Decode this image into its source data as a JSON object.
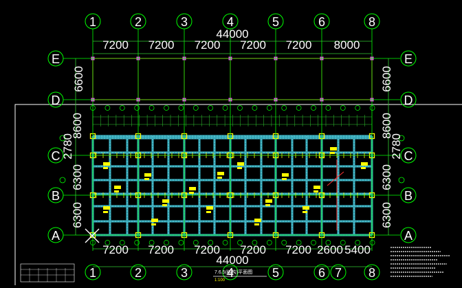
{
  "colors": {
    "axis_green": "#00ff00",
    "dim_green": "#33cc33",
    "axis_white": "#ffffff",
    "span_red": "#ff3333",
    "beam_cyan": "#34a7b7",
    "beam_light": "#7fd9e6",
    "column_yellow": "#ffff00",
    "node_magenta": "#ff44ff",
    "border_white": "#ffffff"
  },
  "drawing": {
    "grid_x_labels": [
      "1",
      "2",
      "3",
      "4",
      "5",
      "6",
      "8"
    ],
    "grid_y_labels": [
      "E",
      "D",
      "C",
      "B",
      "A"
    ],
    "top_total": "44000",
    "top_spans": [
      "7200",
      "7200",
      "7200",
      "7200",
      "7200",
      "8000"
    ],
    "left_spans_upper": [
      "6600"
    ],
    "right_spans_upper": [
      "6600"
    ],
    "left_spans_lower": [
      "8600",
      "2780",
      "6300",
      "6300"
    ],
    "right_spans_lower": [
      "8600",
      "2780",
      "6300",
      "6300"
    ],
    "bottom_spans": [
      "7200",
      "7200",
      "7200",
      "7200",
      "7200",
      "2600",
      "5400"
    ],
    "bottom_total": "44000",
    "bottom_x_labels": [
      "1",
      "2",
      "3",
      "4",
      "5",
      "6",
      "7",
      "8"
    ],
    "plan_title": "7.6.5(结构)平面图",
    "plan_scale": "1:100"
  }
}
